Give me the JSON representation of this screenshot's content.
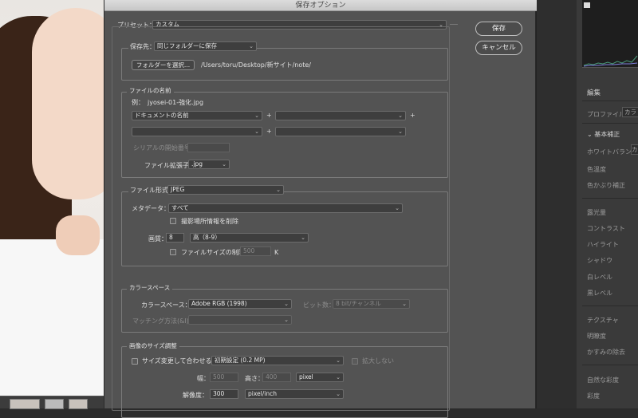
{
  "window_title": "保存オプション",
  "preset": {
    "label": "プリセット：",
    "value": "カスタム"
  },
  "buttons": {
    "save": "保存",
    "cancel": "キャンセル"
  },
  "destination": {
    "label": "保存先：",
    "value": "同じフォルダーに保存",
    "select_folder": "フォルダーを選択...",
    "path": "/Users/toru/Desktop/新サイト/note/"
  },
  "file_naming": {
    "title": "ファイルの名前",
    "example_label": "例：",
    "example_value": "jyosei-01-強化.jpg",
    "field1": "ドキュメントの名前",
    "field2": "",
    "field3": "",
    "field4": "",
    "plus": "+",
    "serial_label": "シリアルの開始番号：",
    "serial_value": "",
    "ext_label": "ファイル拡張子：",
    "ext_value": ".jpg"
  },
  "format": {
    "label": "ファイル形式：",
    "value": "JPEG",
    "metadata_label": "メタデータ：",
    "metadata_value": "すべて",
    "remove_location": "撮影場所情報を削除",
    "quality_label": "画質：",
    "quality_value": "8",
    "quality_level": "高（8-9）",
    "limit_size": "ファイルサイズの制限：",
    "limit_value": "500",
    "limit_unit": "K"
  },
  "color_space": {
    "title": "カラースペース",
    "label": "カラースペース：",
    "value": "Adobe RGB (1998)",
    "bit_label": "ビット数：",
    "bit_value": "8 bit/チャンネル",
    "matching_label": "マッチング方法(&I)：",
    "matching_value": ""
  },
  "resize": {
    "title": "画像のサイズ調整",
    "fit_label": "サイズ変更して合わせる：",
    "fit_value": "初期設定 (0.2 MP)",
    "enlarge": "拡大しない",
    "width_label": "幅：",
    "width_value": "500",
    "height_label": "高さ：",
    "height_value": "400",
    "unit_value": "pixel",
    "resolution_label": "解像度：",
    "resolution_value": "300",
    "resolution_unit": "pixel/inch"
  },
  "side_panel": {
    "section_edit": "編集",
    "profile_label": "プロファイル",
    "profile_value": "カラ",
    "basic": "基本補正",
    "white_balance": "ホワイトバランス",
    "wb_value": "カ",
    "temp": "色温度",
    "tint": "色かぶり補正",
    "exposure": "露光量",
    "contrast": "コントラスト",
    "highlights": "ハイライト",
    "shadows": "シャドウ",
    "whites": "白レベル",
    "blacks": "黒レベル",
    "texture": "テクスチャ",
    "clarity": "明瞭度",
    "dehaze": "かすみの除去",
    "vibrance": "自然な彩度",
    "saturation": "彩度"
  },
  "colors": {
    "dialog_bg": "#535353",
    "panel_bg": "#3a3a3a",
    "histogram": "#1e1e1e"
  }
}
